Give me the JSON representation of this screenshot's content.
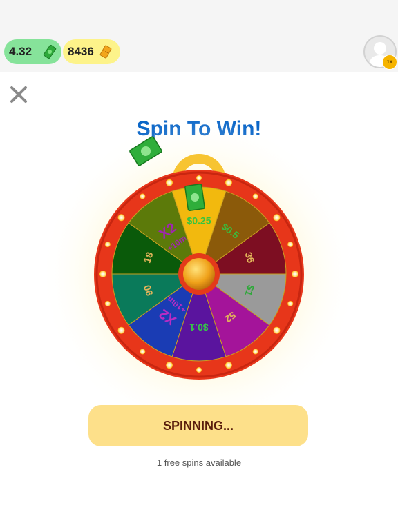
{
  "header": {
    "cash_balance": "4.32",
    "ticket_balance": "8436",
    "multiplier_badge": "1X"
  },
  "spin": {
    "title": "Spin To Win!",
    "button_label": "SPINNING...",
    "free_spins_text": "1 free spins available"
  },
  "wheel": {
    "segments": [
      {
        "label": "$0.25",
        "color": "#f2b90e",
        "text_color": "#39c43e"
      },
      {
        "label": "$0.5",
        "color": "#8b5a0a",
        "text_color": "#3dba3c"
      },
      {
        "label": "36",
        "color": "#7d0e22",
        "text_color": "#e2b45a"
      },
      {
        "label": "$1",
        "color": "#9a9a9a",
        "text_color": "#2fa83a"
      },
      {
        "label": "52",
        "color": "#a4149a",
        "text_color": "#e2b45a"
      },
      {
        "label": "$0.1",
        "color": "#5a149e",
        "text_color": "#36c44a"
      },
      {
        "label": "X2",
        "sub": "+10m",
        "color": "#1a3cb4",
        "text_color": "#b82cc4"
      },
      {
        "label": "90",
        "color": "#0a7a5a",
        "text_color": "#e2b45a"
      },
      {
        "label": "18",
        "color": "#0a5a0a",
        "text_color": "#e2b45a"
      },
      {
        "label": "X2",
        "sub": "+10m",
        "color": "#5c7a0a",
        "text_color": "#a025b0"
      }
    ]
  }
}
